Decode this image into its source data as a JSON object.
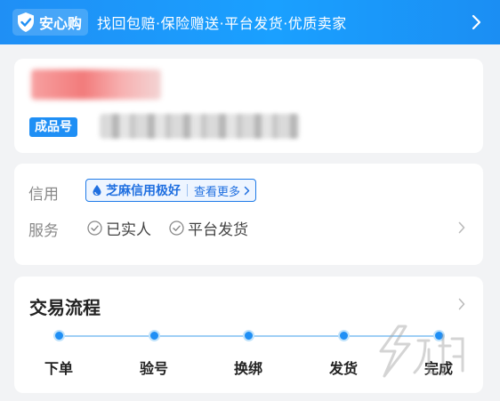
{
  "banner": {
    "badge_label": "安心购",
    "text": "找回包赔·保险赠送·平台发货·优质卖家",
    "icons": [
      "shield-check-icon",
      "chevron-right-icon"
    ]
  },
  "product": {
    "tag": "成品号"
  },
  "info": {
    "credit_label": "信用",
    "credit_value": "芝麻信用极好",
    "credit_more": "查看更多",
    "service_label": "服务",
    "services": [
      "已实人",
      "平台发货"
    ]
  },
  "flow": {
    "title": "交易流程",
    "steps": [
      "下单",
      "验号",
      "换绑",
      "发货",
      "完成"
    ]
  },
  "colors": {
    "accent": "#1f8ff5",
    "credit": "#1f6fe0"
  }
}
